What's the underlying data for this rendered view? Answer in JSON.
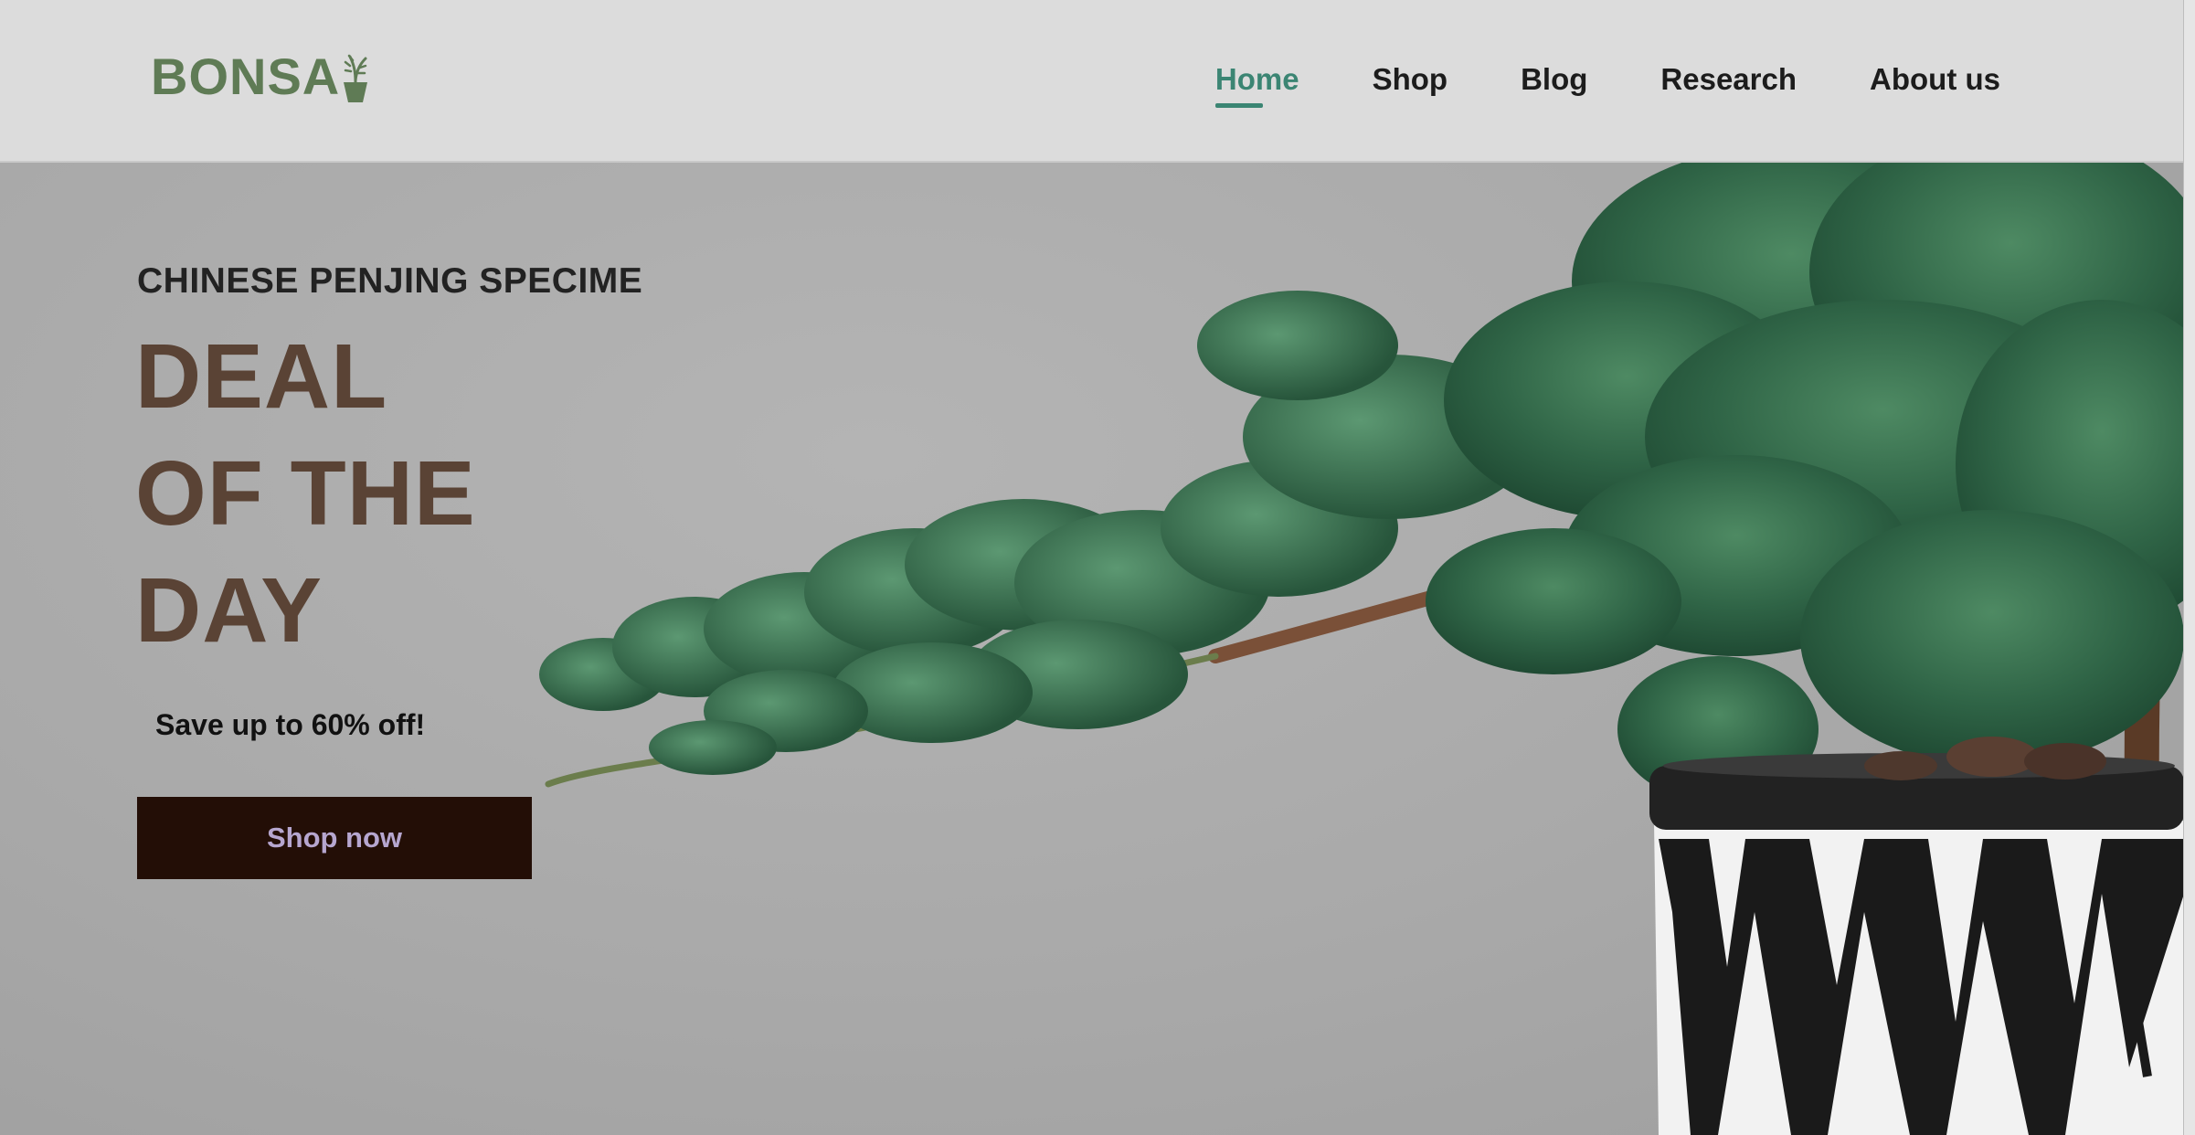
{
  "brand": {
    "logo_text": "BONSA",
    "logo_icon": "potted-plant-icon",
    "color": "#5f7b55"
  },
  "nav": {
    "items": [
      {
        "label": "Home",
        "active": true
      },
      {
        "label": "Shop",
        "active": false
      },
      {
        "label": "Blog",
        "active": false
      },
      {
        "label": "Research",
        "active": false
      },
      {
        "label": "About us",
        "active": false
      }
    ],
    "active_color": "#3b8573"
  },
  "hero": {
    "eyebrow": "CHINESE PENJING SPECIME",
    "headline_lines": [
      "DEAL",
      "OF THE",
      "DAY"
    ],
    "promo": "Save up to 60% off!",
    "cta_label": "Shop now",
    "background_image": "juniper-bonsai-in-patterned-pot",
    "colors": {
      "headline": "#5a4335",
      "cta_background": "#230e06",
      "cta_text": "#b6a6cf"
    }
  }
}
